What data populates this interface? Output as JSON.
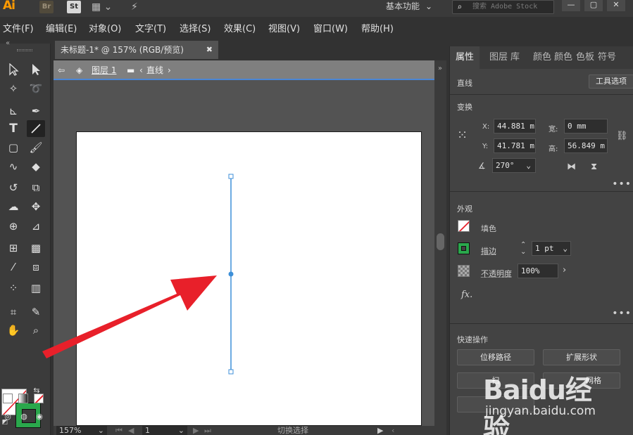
{
  "app": {
    "logo": "Ai",
    "bridge_label": "Br",
    "stock_label": "St",
    "workspace": "基本功能",
    "search_placeholder": "搜索 Adobe Stock"
  },
  "menu": [
    "文件(F)",
    "编辑(E)",
    "对象(O)",
    "文字(T)",
    "选择(S)",
    "效果(C)",
    "视图(V)",
    "窗口(W)",
    "帮助(H)"
  ],
  "document": {
    "tab_title": "未标题-1* @ 157% (RGB/预览)",
    "breadcrumb_layer": "图层 1",
    "breadcrumb_object": "直线"
  },
  "status": {
    "zoom": "157%",
    "page": "1",
    "mode": "切换选择"
  },
  "panel": {
    "tabs": [
      "属性",
      "图层",
      "库",
      "颜色",
      "颜色",
      "色板",
      "符号"
    ],
    "object_type": "直线",
    "tool_options": "工具选项",
    "transform": {
      "title": "变换",
      "x_label": "X:",
      "x": "44.881 m",
      "y_label": "Y:",
      "y": "41.781 m",
      "w_label": "宽:",
      "w": "0 mm",
      "h_label": "高:",
      "h": "56.849 m",
      "angle": "270°"
    },
    "appearance": {
      "title": "外观",
      "fill": "填色",
      "stroke": "描边",
      "stroke_weight": "1 pt",
      "opacity_label": "不透明度",
      "opacity": "100%",
      "fx": "fx."
    },
    "quick_actions": {
      "title": "快速操作",
      "offset_path": "位移路径",
      "expand_shape": "扩展形状",
      "b3_visible": "扫",
      "b4_visible": "网格"
    }
  },
  "watermark": {
    "main": "Baidu经验",
    "sub": "jingyan.baidu.com"
  },
  "colors": {
    "accent_blue": "#4a86d6",
    "stroke_green": "#2aa84c",
    "arrow_red": "#e8202a",
    "line_blue": "#3d8fd8"
  }
}
